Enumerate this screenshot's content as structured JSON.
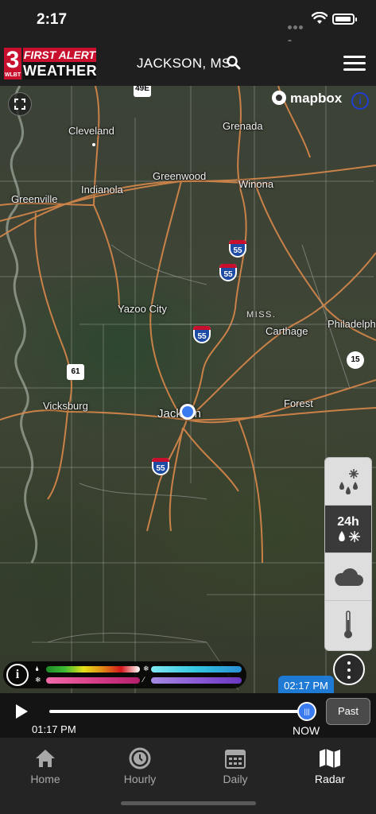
{
  "status_bar": {
    "time": "2:17"
  },
  "header": {
    "logo": {
      "number": "3",
      "station": "WLBT",
      "line1": "FIRST ALERT",
      "line2": "WEATHER"
    },
    "location": "JACKSON, MS"
  },
  "map": {
    "attribution": "mapbox",
    "state_label": "MISS.",
    "cities": [
      {
        "name": "Cleveland"
      },
      {
        "name": "Grenada"
      },
      {
        "name": "Greenwood"
      },
      {
        "name": "Winona"
      },
      {
        "name": "Greenville"
      },
      {
        "name": "Indianola"
      },
      {
        "name": "Yazoo City"
      },
      {
        "name": "Carthage"
      },
      {
        "name": "Philadelphia"
      },
      {
        "name": "Vicksburg"
      },
      {
        "name": "Jackson"
      },
      {
        "name": "Forest"
      }
    ],
    "routes": {
      "i55": "55",
      "i49e": "49E",
      "us61": "61",
      "sr15": "15"
    }
  },
  "layers": {
    "precip_label": "24h"
  },
  "timeline": {
    "current_time": "02:17 PM",
    "start_time": "01:17 PM",
    "now_label": "NOW",
    "past_button": "Past",
    "progress": 1.0
  },
  "tabs": [
    {
      "label": "Home",
      "icon": "home-icon"
    },
    {
      "label": "Hourly",
      "icon": "clock-icon"
    },
    {
      "label": "Daily",
      "icon": "calendar-icon"
    },
    {
      "label": "Radar",
      "icon": "map-icon",
      "active": true
    }
  ],
  "colors": {
    "accent_blue": "#3a7bf0",
    "brand_red": "#c8102e"
  }
}
